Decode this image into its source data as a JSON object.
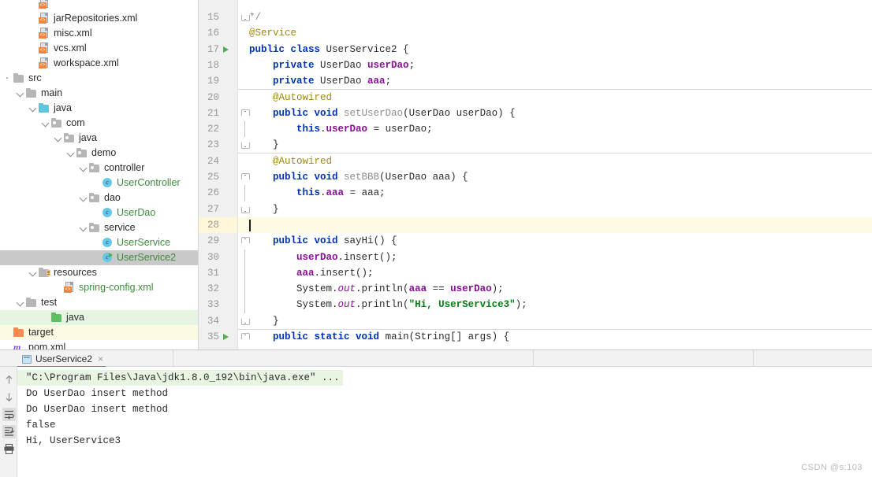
{
  "project_tree": {
    "name": "project-tool-window",
    "items": [
      {
        "label": "",
        "indent": 3,
        "icon": "xml-file-icon",
        "twist": "none",
        "color": "dark",
        "row_bg": "none",
        "clipped": true
      },
      {
        "label": "jarRepositories.xml",
        "indent": 3,
        "icon": "xml-file-icon",
        "twist": "none",
        "color": "dark",
        "row_bg": "none"
      },
      {
        "label": "misc.xml",
        "indent": 3,
        "icon": "xml-file-icon",
        "twist": "none",
        "color": "dark",
        "row_bg": "none"
      },
      {
        "label": "vcs.xml",
        "indent": 3,
        "icon": "xml-file-icon",
        "twist": "none",
        "color": "dark",
        "row_bg": "none"
      },
      {
        "label": "workspace.xml",
        "indent": 3,
        "icon": "xml-file-icon",
        "twist": "none",
        "color": "dark",
        "row_bg": "none"
      },
      {
        "label": "src",
        "indent": 1,
        "icon": "folder-src-icon",
        "twist": "dot",
        "color": "dark",
        "row_bg": "none"
      },
      {
        "label": "main",
        "indent": 2,
        "icon": "folder-gray-icon",
        "twist": "open",
        "color": "dark",
        "row_bg": "none"
      },
      {
        "label": "java",
        "indent": 3,
        "icon": "folder-blue-icon",
        "twist": "open",
        "color": "dark",
        "row_bg": "none"
      },
      {
        "label": "com",
        "indent": 4,
        "icon": "folder-pkg-icon",
        "twist": "open",
        "color": "dark",
        "row_bg": "none"
      },
      {
        "label": "java",
        "indent": 5,
        "icon": "folder-pkg-icon",
        "twist": "open",
        "color": "dark",
        "row_bg": "none"
      },
      {
        "label": "demo",
        "indent": 6,
        "icon": "folder-pkg-icon",
        "twist": "open",
        "color": "dark",
        "row_bg": "none"
      },
      {
        "label": "controller",
        "indent": 7,
        "icon": "folder-pkg-icon",
        "twist": "open",
        "color": "dark",
        "row_bg": "none"
      },
      {
        "label": "UserController",
        "indent": 8,
        "icon": "java-class-icon",
        "twist": "none",
        "color": "green",
        "row_bg": "none"
      },
      {
        "label": "dao",
        "indent": 7,
        "icon": "folder-pkg-icon",
        "twist": "open",
        "color": "dark",
        "row_bg": "none"
      },
      {
        "label": "UserDao",
        "indent": 8,
        "icon": "java-class-icon",
        "twist": "none",
        "color": "green",
        "row_bg": "none"
      },
      {
        "label": "service",
        "indent": 7,
        "icon": "folder-pkg-icon",
        "twist": "open",
        "color": "dark",
        "row_bg": "none"
      },
      {
        "label": "UserService",
        "indent": 8,
        "icon": "java-class-icon",
        "twist": "none",
        "color": "green",
        "row_bg": "none"
      },
      {
        "label": "UserService2",
        "indent": 8,
        "icon": "java-class-runnable-icon",
        "twist": "none",
        "color": "green",
        "row_bg": "selected"
      },
      {
        "label": "resources",
        "indent": 3,
        "icon": "folder-resources-icon",
        "twist": "open",
        "color": "dark",
        "row_bg": "none"
      },
      {
        "label": "spring-config.xml",
        "indent": 5,
        "icon": "xml-file-icon",
        "twist": "none",
        "color": "green",
        "row_bg": "none"
      },
      {
        "label": "test",
        "indent": 2,
        "icon": "folder-gray-icon",
        "twist": "open",
        "color": "dark",
        "row_bg": "none"
      },
      {
        "label": "java",
        "indent": 4,
        "icon": "folder-green-icon",
        "twist": "none",
        "color": "dark",
        "row_bg": "green"
      },
      {
        "label": "target",
        "indent": 1,
        "icon": "folder-orange-icon",
        "twist": "none",
        "color": "dark",
        "row_bg": "yellow"
      },
      {
        "label": "pom.xml",
        "indent": 1,
        "icon": "maven-pom-icon",
        "twist": "none",
        "color": "dark",
        "row_bg": "none",
        "clipped_bottom": true
      }
    ]
  },
  "editor": {
    "name": "code-editor",
    "lines": [
      {
        "num": "15",
        "fold": "botcap",
        "run": false,
        "tokens": [
          {
            "t": "*/",
            "c": "cmt"
          }
        ]
      },
      {
        "num": "16",
        "fold": "none",
        "run": false,
        "tokens": [
          {
            "t": "@Service",
            "c": "ann"
          }
        ]
      },
      {
        "num": "17",
        "fold": "none",
        "run": true,
        "tokens": [
          {
            "t": "public ",
            "c": "kw"
          },
          {
            "t": "class ",
            "c": "kw"
          },
          {
            "t": "UserService2 {",
            "c": "pln"
          }
        ]
      },
      {
        "num": "18",
        "fold": "none",
        "run": false,
        "tokens": [
          {
            "t": "    ",
            "c": "pln"
          },
          {
            "t": "private ",
            "c": "kw"
          },
          {
            "t": "UserDao ",
            "c": "pln"
          },
          {
            "t": "userDao",
            "c": "fld"
          },
          {
            "t": ";",
            "c": "pln"
          }
        ]
      },
      {
        "num": "19",
        "fold": "none",
        "run": false,
        "sep_below": true,
        "tokens": [
          {
            "t": "    ",
            "c": "pln"
          },
          {
            "t": "private ",
            "c": "kw"
          },
          {
            "t": "UserDao ",
            "c": "pln"
          },
          {
            "t": "aaa",
            "c": "fld"
          },
          {
            "t": ";",
            "c": "pln"
          }
        ]
      },
      {
        "num": "20",
        "fold": "none",
        "run": false,
        "tokens": [
          {
            "t": "    ",
            "c": "pln"
          },
          {
            "t": "@Autowired",
            "c": "ann"
          }
        ]
      },
      {
        "num": "21",
        "fold": "topcap",
        "run": false,
        "tokens": [
          {
            "t": "    ",
            "c": "pln"
          },
          {
            "t": "public ",
            "c": "kw"
          },
          {
            "t": "void ",
            "c": "kw"
          },
          {
            "t": "setUserDao",
            "c": "mtd"
          },
          {
            "t": "(UserDao userDao) {",
            "c": "pln"
          }
        ]
      },
      {
        "num": "22",
        "fold": "line",
        "run": false,
        "tokens": [
          {
            "t": "        ",
            "c": "pln"
          },
          {
            "t": "this",
            "c": "kw"
          },
          {
            "t": ".",
            "c": "pln"
          },
          {
            "t": "userDao",
            "c": "fld"
          },
          {
            "t": " = userDao;",
            "c": "pln"
          }
        ]
      },
      {
        "num": "23",
        "fold": "botcap",
        "run": false,
        "sep_below": true,
        "tokens": [
          {
            "t": "    }",
            "c": "pln"
          }
        ]
      },
      {
        "num": "24",
        "fold": "none",
        "run": false,
        "tokens": [
          {
            "t": "    ",
            "c": "pln"
          },
          {
            "t": "@Autowired",
            "c": "ann"
          }
        ]
      },
      {
        "num": "25",
        "fold": "topcap",
        "run": false,
        "tokens": [
          {
            "t": "    ",
            "c": "pln"
          },
          {
            "t": "public ",
            "c": "kw"
          },
          {
            "t": "void ",
            "c": "kw"
          },
          {
            "t": "setBBB",
            "c": "mtd"
          },
          {
            "t": "(UserDao aaa) {",
            "c": "pln"
          }
        ]
      },
      {
        "num": "26",
        "fold": "line",
        "run": false,
        "tokens": [
          {
            "t": "        ",
            "c": "pln"
          },
          {
            "t": "this",
            "c": "kw"
          },
          {
            "t": ".",
            "c": "pln"
          },
          {
            "t": "aaa",
            "c": "fld"
          },
          {
            "t": " = aaa;",
            "c": "pln"
          }
        ]
      },
      {
        "num": "27",
        "fold": "botcap",
        "run": false,
        "tokens": [
          {
            "t": "    }",
            "c": "pln"
          }
        ]
      },
      {
        "num": "28",
        "fold": "none",
        "run": false,
        "current": true,
        "caret": true,
        "tokens": []
      },
      {
        "num": "29",
        "fold": "topcap",
        "run": false,
        "tokens": [
          {
            "t": "    ",
            "c": "pln"
          },
          {
            "t": "public ",
            "c": "kw"
          },
          {
            "t": "void ",
            "c": "kw"
          },
          {
            "t": "sayHi",
            "c": "pln"
          },
          {
            "t": "() {",
            "c": "pln"
          }
        ]
      },
      {
        "num": "30",
        "fold": "line",
        "run": false,
        "tokens": [
          {
            "t": "        ",
            "c": "pln"
          },
          {
            "t": "userDao",
            "c": "fld"
          },
          {
            "t": ".insert();",
            "c": "pln"
          }
        ]
      },
      {
        "num": "31",
        "fold": "line",
        "run": false,
        "tokens": [
          {
            "t": "        ",
            "c": "pln"
          },
          {
            "t": "aaa",
            "c": "fld"
          },
          {
            "t": ".insert();",
            "c": "pln"
          }
        ]
      },
      {
        "num": "32",
        "fold": "line",
        "run": false,
        "tokens": [
          {
            "t": "        System.",
            "c": "pln"
          },
          {
            "t": "out",
            "c": "stat"
          },
          {
            "t": ".println(",
            "c": "pln"
          },
          {
            "t": "aaa",
            "c": "fld"
          },
          {
            "t": " == ",
            "c": "pln"
          },
          {
            "t": "userDao",
            "c": "fld"
          },
          {
            "t": ");",
            "c": "pln"
          }
        ]
      },
      {
        "num": "33",
        "fold": "line",
        "run": false,
        "tokens": [
          {
            "t": "        System.",
            "c": "pln"
          },
          {
            "t": "out",
            "c": "stat"
          },
          {
            "t": ".println(",
            "c": "pln"
          },
          {
            "t": "\"Hi, UserService3\"",
            "c": "str"
          },
          {
            "t": ");",
            "c": "pln"
          }
        ]
      },
      {
        "num": "34",
        "fold": "botcap",
        "run": false,
        "sep_below": true,
        "tokens": [
          {
            "t": "    }",
            "c": "pln"
          }
        ]
      },
      {
        "num": "35",
        "fold": "topcap",
        "run": true,
        "tokens": [
          {
            "t": "    ",
            "c": "pln"
          },
          {
            "t": "public ",
            "c": "kw"
          },
          {
            "t": "static ",
            "c": "kw"
          },
          {
            "t": "void ",
            "c": "kw"
          },
          {
            "t": "main",
            "c": "pln"
          },
          {
            "t": "(String[] args) {",
            "c": "pln"
          }
        ]
      }
    ]
  },
  "console": {
    "name": "run-tool-window",
    "tab_label": "UserService2",
    "tab_close": "×",
    "buttons": [
      {
        "name": "up-arrow-icon",
        "active": false
      },
      {
        "name": "down-arrow-icon",
        "active": false
      },
      {
        "name": "soft-wrap-icon",
        "active": true
      },
      {
        "name": "scroll-to-end-icon",
        "active": true
      },
      {
        "name": "print-icon",
        "active": false
      }
    ],
    "output": [
      {
        "text": "\"C:\\Program Files\\Java\\jdk1.8.0_192\\bin\\java.exe\" ...",
        "highlight": true
      },
      {
        "text": "Do UserDao insert method",
        "highlight": false
      },
      {
        "text": "Do UserDao insert method",
        "highlight": false
      },
      {
        "text": "false",
        "highlight": false
      },
      {
        "text": "Hi, UserService3",
        "highlight": false
      }
    ]
  },
  "watermark": {
    "text": "CSDN @s:103"
  },
  "colors": {
    "keyword": "#0033b3",
    "annotation": "#9e880d",
    "field": "#871094",
    "method": "#8e8e8e",
    "string": "#067d17",
    "tree_green": "#3d8b3d",
    "selection": "#c9c9c9",
    "current_line": "#fffae3",
    "tab_underline": "#4a86c5",
    "console_cmd_bg": "#e8f5e2"
  }
}
